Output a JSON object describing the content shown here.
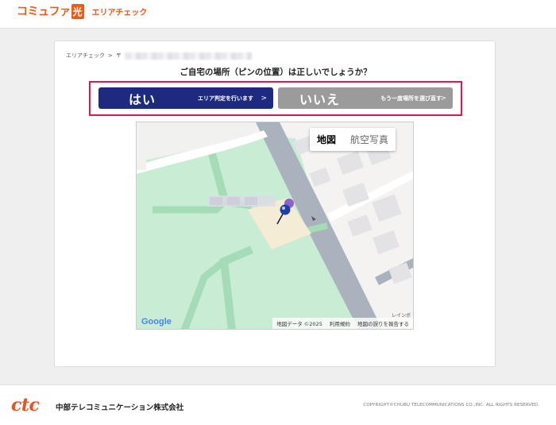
{
  "header": {
    "brand_main": "コミュファ",
    "brand_hikari": "光",
    "subtitle": "エリアチェック"
  },
  "breadcrumb": {
    "first": "エリアチェック",
    "separator": ">",
    "second_prefix": "〒"
  },
  "question": "ご自宅の場所（ピンの位置）は正しいでしょうか？",
  "yes_button": {
    "main": "はい",
    "sub": "エリア判定を行います",
    "chevron": ">"
  },
  "no_button": {
    "main": "いいえ",
    "sub": "もう一度場所を選び直す",
    "chevron": ">"
  },
  "map": {
    "toggle_map": "地図",
    "toggle_satellite": "航空写真",
    "google_logo": "Google",
    "attribution_data": "地図データ ©2025",
    "attribution_terms": "利用規約",
    "attribution_report": "地図の誤りを報告する",
    "place_label": "レインボ"
  },
  "footer": {
    "logo": "ctc",
    "company": "中部テレコミュニケーション株式会社",
    "copyright": "COPYRIGHT©CHUBU TELECOMMUNICATIONS CO.,INC. ALL RIGHTS RESERVED."
  },
  "colors": {
    "brand_orange": "#f05a14",
    "yes_button": "#1c2a7f",
    "no_button": "#9b9b9b",
    "highlight_frame": "#e0134d",
    "park_green": "#c8ecd4"
  }
}
